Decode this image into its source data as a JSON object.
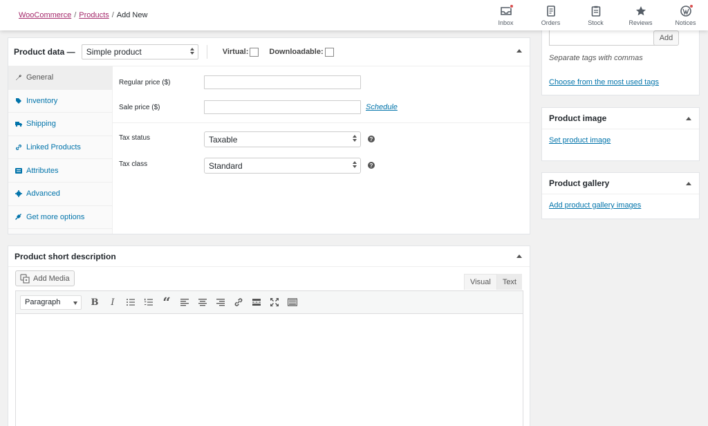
{
  "breadcrumb": {
    "root": "WooCommerce",
    "section": "Products",
    "current": "Add New",
    "separator": "/"
  },
  "activity": [
    {
      "label": "Inbox",
      "icon": "inbox-icon",
      "badge": true
    },
    {
      "label": "Orders",
      "icon": "orders-icon",
      "badge": false
    },
    {
      "label": "Stock",
      "icon": "stock-icon",
      "badge": false
    },
    {
      "label": "Reviews",
      "icon": "star-icon",
      "badge": false
    },
    {
      "label": "Notices",
      "icon": "wordpress-icon",
      "badge": true
    }
  ],
  "product_data": {
    "title": "Product data —",
    "type_selected": "Simple product",
    "virtual_label": "Virtual:",
    "virtual_checked": false,
    "downloadable_label": "Downloadable:",
    "downloadable_checked": false,
    "tabs": [
      {
        "label": "General",
        "icon": "wrench-icon"
      },
      {
        "label": "Inventory",
        "icon": "tag-icon"
      },
      {
        "label": "Shipping",
        "icon": "truck-icon"
      },
      {
        "label": "Linked Products",
        "icon": "link-icon"
      },
      {
        "label": "Attributes",
        "icon": "list-icon"
      },
      {
        "label": "Advanced",
        "icon": "gear-icon"
      },
      {
        "label": "Get more options",
        "icon": "plugin-icon"
      }
    ],
    "active_tab": "General",
    "fields": {
      "regular_price_label": "Regular price ($)",
      "regular_price_value": "",
      "sale_price_label": "Sale price ($)",
      "sale_price_value": "",
      "schedule_link": "Schedule",
      "tax_status_label": "Tax status",
      "tax_status_value": "Taxable",
      "tax_class_label": "Tax class",
      "tax_class_value": "Standard",
      "help_glyph": "?"
    }
  },
  "short_description": {
    "title": "Product short description",
    "add_media": "Add Media",
    "tab_visual": "Visual",
    "tab_text": "Text",
    "format_selected": "Paragraph",
    "bold_glyph": "B",
    "italic_glyph": "I",
    "quote_glyph": "“"
  },
  "tags": {
    "add_button": "Add",
    "hint": "Separate tags with commas",
    "most_used_link": "Choose from the most used tags"
  },
  "product_image": {
    "title": "Product image",
    "link": "Set product image"
  },
  "product_gallery": {
    "title": "Product gallery",
    "link": "Add product gallery images"
  },
  "colors": {
    "brand_purple": "#a4286a",
    "link_blue": "#0073aa",
    "badge_red": "#d94f4f"
  }
}
